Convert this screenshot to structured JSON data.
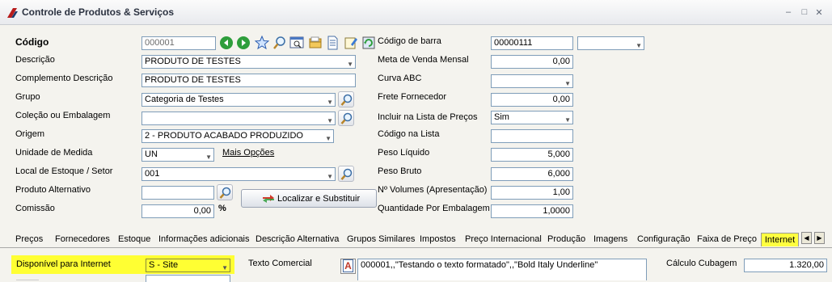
{
  "window": {
    "title": "Controle de Produtos & Serviços",
    "controls": [
      "–",
      "□",
      "✕"
    ]
  },
  "left_form": {
    "codigo_label": "Código",
    "codigo_value": "000001",
    "descricao_label": "Descrição",
    "descricao_value": "PRODUTO DE TESTES",
    "complemento_label": "Complemento Descrição",
    "complemento_value": "PRODUTO DE TESTES",
    "grupo_label": "Grupo",
    "grupo_value": "Categoria de Testes",
    "colecao_label": "Coleção ou Embalagem",
    "colecao_value": "",
    "origem_label": "Origem",
    "origem_value": "2 - PRODUTO ACABADO PRODUZIDO",
    "unidade_label": "Unidade de Medida",
    "unidade_value": "UN",
    "mais_opcoes": "Mais Opções",
    "local_label": "Local de Estoque / Setor",
    "local_value": "001",
    "alternativo_label": "Produto Alternativo",
    "alternativo_value": "",
    "comissao_label": "Comissão",
    "comissao_value": "0,00",
    "comissao_unit": "%",
    "localizar_button": "Localizar e Substituir"
  },
  "right_form": {
    "codigo_barra_label": "Código de barra",
    "codigo_barra_value": "00000111",
    "codigo_barra_extra": "",
    "meta_label": "Meta de Venda Mensal",
    "meta_value": "0,00",
    "curva_label": "Curva ABC",
    "curva_value": "",
    "frete_label": "Frete Fornecedor",
    "frete_value": "0,00",
    "incluir_label": "Incluir na Lista de Preços",
    "incluir_value": "Sim",
    "codigo_lista_label": "Código na Lista",
    "codigo_lista_value": "",
    "peso_liquido_label": "Peso Líquido",
    "peso_liquido_value": "5,000",
    "peso_bruto_label": "Peso Bruto",
    "peso_bruto_value": "6,000",
    "volumes_label": "Nº Volumes (Apresentação)",
    "volumes_value": "1,00",
    "qtd_embalagem_label": "Quantidade Por Embalagem",
    "qtd_embalagem_value": "1,0000"
  },
  "tabs": [
    "Preços",
    "Fornecedores",
    "Estoque",
    "Informações adicionais",
    "Descrição Alternativa",
    "Grupos Similares",
    "Impostos",
    "Preço Internacional",
    "Produção",
    "Imagens",
    "Configuração",
    "Faixa de Preço",
    "Internet"
  ],
  "internet_tab": {
    "disponivel_label": "Disponível para Internet",
    "disponivel_value": "S - Site",
    "texto_comercial_label": "Texto Comercial",
    "texto_comercial_value": "000001,,\"Testando o texto  formatado\",,\"Bold Italy  Underline\"",
    "calculo_cubagem_label": "Cálculo Cubagem",
    "calculo_cubagem_value": "1.320,00"
  },
  "colors": {
    "highlight": "#ffff33",
    "active_tab": "#ffff40"
  }
}
